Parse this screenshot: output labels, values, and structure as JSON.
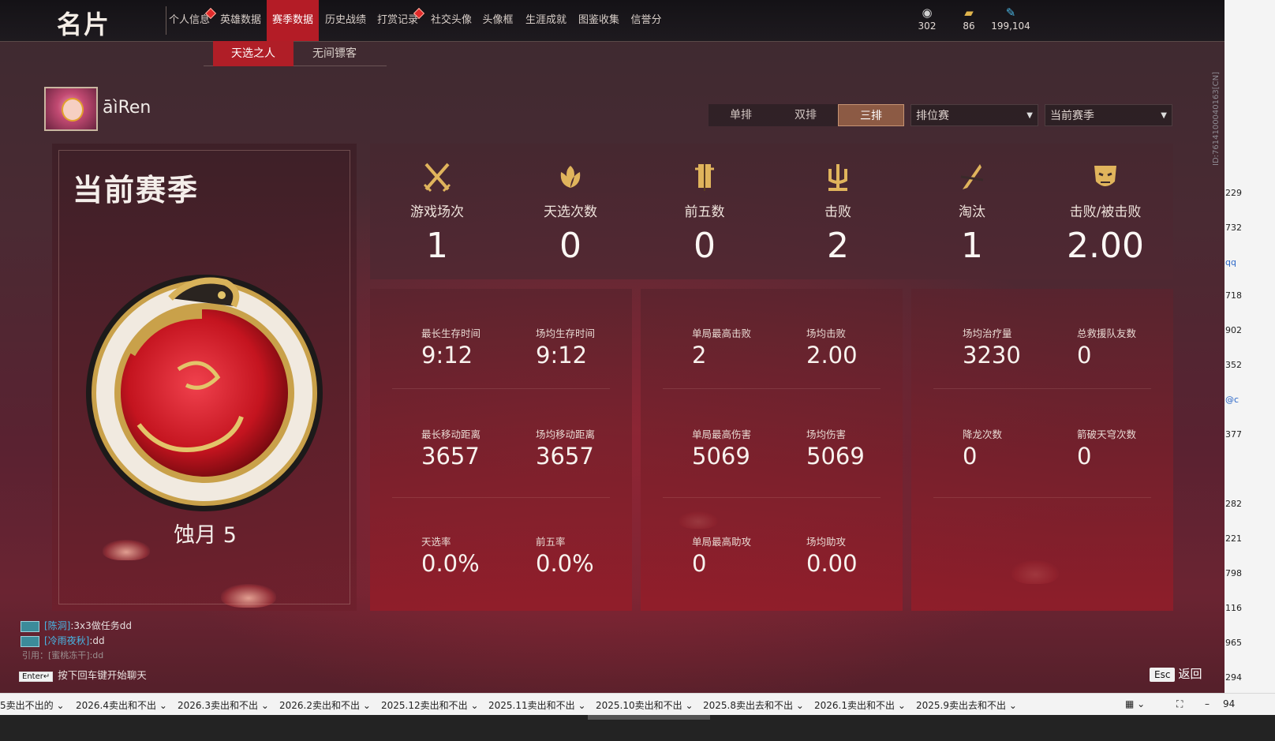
{
  "header": {
    "title": "名片",
    "nav": [
      {
        "label": "个人信息",
        "active": false,
        "dot": true
      },
      {
        "label": "英雄数据",
        "active": false,
        "dot": false
      },
      {
        "label": "赛季数据",
        "active": true,
        "dot": false
      },
      {
        "label": "历史战绩",
        "active": false,
        "dot": false
      },
      {
        "label": "打赏记录",
        "active": false,
        "dot": true
      },
      {
        "label": "社交头像",
        "active": false,
        "dot": false
      },
      {
        "label": "头像框",
        "active": false,
        "dot": false
      },
      {
        "label": "生涯成就",
        "active": false,
        "dot": false
      },
      {
        "label": "图鉴收集",
        "active": false,
        "dot": false
      },
      {
        "label": "信誉分",
        "active": false,
        "dot": false
      }
    ],
    "currencies": [
      {
        "icon": "coin-icon",
        "value": "302"
      },
      {
        "icon": "ticket-icon",
        "value": "86"
      },
      {
        "icon": "feather-icon",
        "value": "199,104"
      }
    ]
  },
  "subtabs": [
    "天选之人",
    "无间镖客"
  ],
  "profile": {
    "name": "āìRen"
  },
  "filters": {
    "modes": [
      "单排",
      "双排",
      "三排"
    ],
    "active_mode": "三排",
    "match_type": "排位赛",
    "season_select": "当前赛季"
  },
  "season": {
    "title": "当前赛季",
    "rank": "蚀月 5"
  },
  "summary": [
    {
      "icon": "crossed-swords-icon",
      "label": "游戏场次",
      "value": "1"
    },
    {
      "icon": "lotus-crest-icon",
      "label": "天选次数",
      "value": "0"
    },
    {
      "icon": "banner-icon",
      "label": "前五数",
      "value": "0"
    },
    {
      "icon": "trident-icon",
      "label": "击败",
      "value": "2"
    },
    {
      "icon": "broken-blade-icon",
      "label": "淘汰",
      "value": "1"
    },
    {
      "icon": "demon-mask-icon",
      "label": "击败/被击败",
      "value": "2.00"
    }
  ],
  "details": [
    {
      "cells": [
        {
          "label": "最长生存时间",
          "value": "9:12"
        },
        {
          "label": "场均生存时间",
          "value": "9:12"
        },
        {
          "label": "最长移动距离",
          "value": "3657"
        },
        {
          "label": "场均移动距离",
          "value": "3657"
        },
        {
          "label": "天选率",
          "value": "0.0%"
        },
        {
          "label": "前五率",
          "value": "0.0%"
        }
      ]
    },
    {
      "cells": [
        {
          "label": "单局最高击败",
          "value": "2"
        },
        {
          "label": "场均击败",
          "value": "2.00"
        },
        {
          "label": "单局最高伤害",
          "value": "5069"
        },
        {
          "label": "场均伤害",
          "value": "5069"
        },
        {
          "label": "单局最高助攻",
          "value": "0"
        },
        {
          "label": "场均助攻",
          "value": "0.00"
        }
      ]
    },
    {
      "cells": [
        {
          "label": "场均治疗量",
          "value": "3230"
        },
        {
          "label": "总救援队友数",
          "value": "0"
        },
        {
          "label": "降龙次数",
          "value": "0"
        },
        {
          "label": "箭破天穹次数",
          "value": "0"
        }
      ]
    }
  ],
  "chat": {
    "lines": [
      {
        "name": "[陈洞]",
        "text": ":3x3做任务dd"
      },
      {
        "name": "[冷雨夜秋]",
        "text": ":dd"
      }
    ],
    "quote": "引用：[蜜桃冻干]:dd",
    "enter_key": "Enter↵",
    "hint": "按下回车键开始聊天"
  },
  "esc": {
    "key": "Esc",
    "label": "返回"
  },
  "side_id": "ID:7614100040163[CN]",
  "right_strip_numbers": [
    "229",
    "732",
    "qq",
    "718",
    "902",
    "352",
    "@c",
    "377",
    "282",
    "221",
    "798",
    "116",
    "965",
    "294"
  ],
  "taskbar": {
    "items": [
      "5卖出不出的",
      "2026.4卖出和不出",
      "2026.3卖出和不出",
      "2026.2卖出和不出",
      "2025.12卖出和不出",
      "2025.11卖出和不出",
      "2025.10卖出和不出",
      "2025.8卖出去和不出",
      "2026.1卖出和不出",
      "2025.9卖出去和不出"
    ],
    "zoom": "94"
  },
  "colors": {
    "accent": "#b41c26",
    "mode_active": "#8c5a44",
    "chat_name": "#48b8e8"
  }
}
